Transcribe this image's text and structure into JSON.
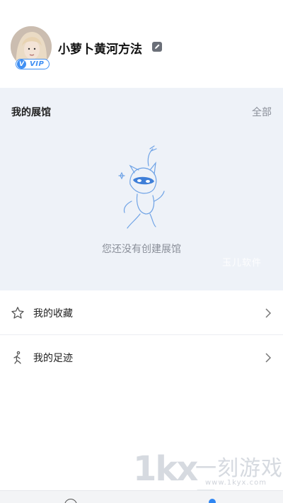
{
  "profile": {
    "username": "小萝卜黄河方法",
    "vip_badge": "VIP",
    "vip_letter": "V",
    "edit_icon": "edit-icon"
  },
  "gallery": {
    "title": "我的展馆",
    "all_link": "全部",
    "empty_text": "您还没有创建展馆",
    "watermark": "玉儿软件"
  },
  "menu": {
    "items": [
      {
        "label": "我的收藏",
        "icon": "star-icon"
      },
      {
        "label": "我的足迹",
        "icon": "footprint-icon"
      }
    ]
  },
  "watermark": {
    "logo": "1kx",
    "name": "一刻游戏网",
    "url": "www.1kyx.com"
  },
  "colors": {
    "accent": "#2f86f2",
    "gallery_bg": "#eef2f8",
    "muted_text": "#8a8f99"
  }
}
